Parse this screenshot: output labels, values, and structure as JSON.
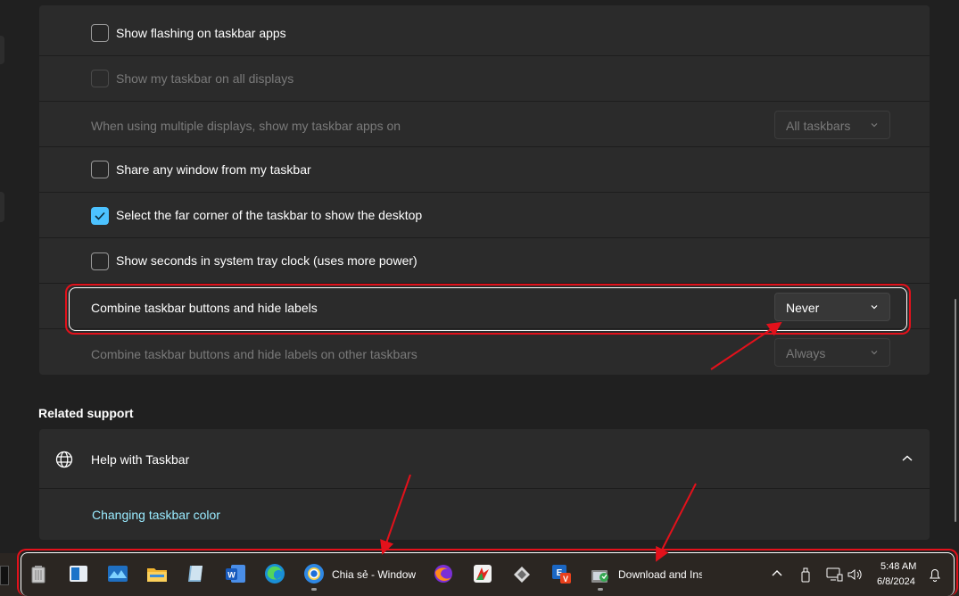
{
  "settings": {
    "rows": [
      {
        "label": "Show flashing on taskbar apps",
        "checked": false,
        "enabled": true
      },
      {
        "label": "Show my taskbar on all displays",
        "checked": false,
        "enabled": false
      },
      {
        "label": "When using multiple displays, show my taskbar apps on",
        "dropdown": "All taskbars",
        "enabled": false
      },
      {
        "label": "Share any window from my taskbar",
        "checked": false,
        "enabled": true
      },
      {
        "label": "Select the far corner of the taskbar to show the desktop",
        "checked": true,
        "enabled": true
      },
      {
        "label": "Show seconds in system tray clock (uses more power)",
        "checked": false,
        "enabled": true
      },
      {
        "label": "Combine taskbar buttons and hide labels",
        "dropdown": "Never",
        "enabled": true
      },
      {
        "label": "Combine taskbar buttons and hide labels on other taskbars",
        "dropdown": "Always",
        "enabled": false
      }
    ]
  },
  "related": {
    "title": "Related support",
    "help_label": "Help with Taskbar",
    "link": "Changing taskbar color"
  },
  "taskbar": {
    "apps": [
      {
        "icon": "recycle-bin-icon"
      },
      {
        "icon": "sticky-app-icon"
      },
      {
        "icon": "photos-icon"
      },
      {
        "icon": "file-explorer-icon"
      },
      {
        "icon": "notepad-icon"
      },
      {
        "icon": "word-icon"
      },
      {
        "icon": "edge-icon"
      },
      {
        "icon": "chrome-icon",
        "label": "Chia sẻ - Window"
      },
      {
        "icon": "firefox-icon"
      },
      {
        "icon": "foxit-icon"
      },
      {
        "icon": "snipping-icon"
      },
      {
        "icon": "unikey-icon"
      },
      {
        "icon": "installer-icon",
        "label": "Download and Ins"
      }
    ],
    "clock": {
      "time": "5:48 AM",
      "date": "6/8/2024"
    },
    "tray": [
      "chevron-up-icon",
      "usb-icon",
      "network-icon",
      "volume-icon",
      "notification-icon"
    ]
  },
  "colors": {
    "accent": "#4cc2ff",
    "highlight": "#e3111b",
    "link": "#99ebff"
  }
}
